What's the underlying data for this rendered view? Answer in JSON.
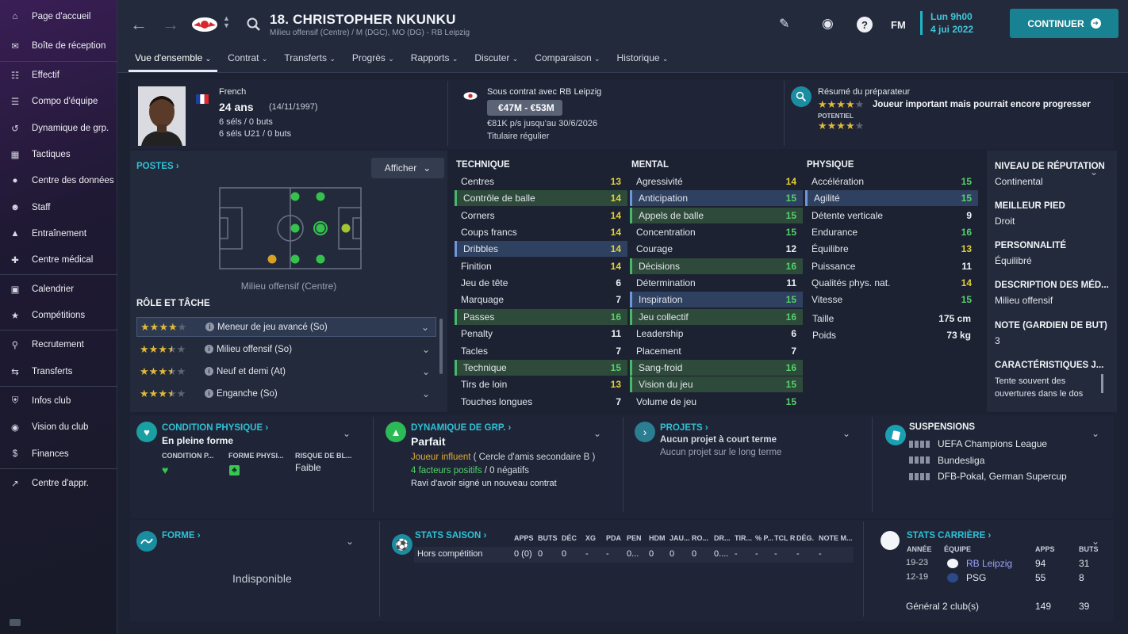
{
  "sidebar": {
    "items": [
      {
        "label": "Page d'accueil",
        "icon": "home-icon"
      },
      {
        "label": "Boîte de réception",
        "icon": "inbox-icon"
      },
      {
        "label": "Effectif",
        "icon": "squad-icon"
      },
      {
        "label": "Compo d'équipe",
        "icon": "clipboard-icon"
      },
      {
        "label": "Dynamique de grp.",
        "icon": "dynamics-icon"
      },
      {
        "label": "Tactiques",
        "icon": "tactics-icon"
      },
      {
        "label": "Centre des données",
        "icon": "data-icon"
      },
      {
        "label": "Staff",
        "icon": "staff-icon"
      },
      {
        "label": "Entraînement",
        "icon": "training-icon"
      },
      {
        "label": "Centre médical",
        "icon": "medical-icon"
      },
      {
        "label": "Calendrier",
        "icon": "calendar-icon"
      },
      {
        "label": "Compétitions",
        "icon": "trophy-icon"
      },
      {
        "label": "Recrutement",
        "icon": "search-icon"
      },
      {
        "label": "Transferts",
        "icon": "transfers-icon"
      },
      {
        "label": "Infos club",
        "icon": "shield-icon"
      },
      {
        "label": "Vision du club",
        "icon": "vision-icon"
      },
      {
        "label": "Finances",
        "icon": "finances-icon"
      },
      {
        "label": "Centre d'appr.",
        "icon": "learning-icon"
      }
    ]
  },
  "header": {
    "title": "18. CHRISTOPHER NKUNKU",
    "subtitle": "Milieu offensif (Centre) / M (DGC), MO (DG) - RB Leipzig",
    "fm_label": "FM",
    "date_line1": "Lun 9h00",
    "date_line2": "4 jui 2022",
    "continue_label": "CONTINUER",
    "tabs": [
      "Vue d'ensemble",
      "Contrat",
      "Transferts",
      "Progrès",
      "Rapports",
      "Discuter",
      "Comparaison",
      "Historique"
    ]
  },
  "profile": {
    "nationality": "French",
    "age": "24 ans",
    "dob": "(14/11/1997)",
    "caps": "6 séls / 0 buts",
    "caps_u21": "6 séls U21 / 0 buts",
    "contract_label": "Sous contrat avec RB Leipzig",
    "value_range": "€47M - €53M",
    "wage": "€81K p/s jusqu'au 30/6/2026",
    "status": "Titulaire régulier",
    "coach_title": "Résumé du préparateur",
    "coach_summary": "Joueur important mais pourrait encore progresser",
    "potential_label": "POTENTIEL",
    "current_stars": 4,
    "potential_stars": 4
  },
  "positions": {
    "title": "POSTES",
    "show_label": "Afficher",
    "position_label": "Milieu offensif (Centre)",
    "role_title": "RÔLE ET TÂCHE",
    "roles": [
      {
        "label": "Meneur de jeu avancé (So)",
        "stars": 4
      },
      {
        "label": "Milieu offensif (So)",
        "stars": 3.5
      },
      {
        "label": "Neuf et demi (At)",
        "stars": 3.5
      },
      {
        "label": "Enganche (So)",
        "stars": 3.5
      }
    ]
  },
  "attributes": {
    "technique_title": "TECHNIQUE",
    "mental_title": "MENTAL",
    "physique_title": "PHYSIQUE",
    "technique": [
      {
        "name": "Centres",
        "value": 13,
        "hl": ""
      },
      {
        "name": "Contrôle de balle",
        "value": 14,
        "hl": "green"
      },
      {
        "name": "Corners",
        "value": 14,
        "hl": ""
      },
      {
        "name": "Coups francs",
        "value": 14,
        "hl": ""
      },
      {
        "name": "Dribbles",
        "value": 14,
        "hl": "blue"
      },
      {
        "name": "Finition",
        "value": 14,
        "hl": ""
      },
      {
        "name": "Jeu de tête",
        "value": 6,
        "hl": ""
      },
      {
        "name": "Marquage",
        "value": 7,
        "hl": ""
      },
      {
        "name": "Passes",
        "value": 16,
        "hl": "green"
      },
      {
        "name": "Penalty",
        "value": 11,
        "hl": ""
      },
      {
        "name": "Tacles",
        "value": 7,
        "hl": ""
      },
      {
        "name": "Technique",
        "value": 15,
        "hl": "green"
      },
      {
        "name": "Tirs de loin",
        "value": 13,
        "hl": ""
      },
      {
        "name": "Touches longues",
        "value": 7,
        "hl": ""
      }
    ],
    "mental": [
      {
        "name": "Agressivité",
        "value": 14,
        "hl": ""
      },
      {
        "name": "Anticipation",
        "value": 15,
        "hl": "blue"
      },
      {
        "name": "Appels de balle",
        "value": 15,
        "hl": "green"
      },
      {
        "name": "Concentration",
        "value": 15,
        "hl": ""
      },
      {
        "name": "Courage",
        "value": 12,
        "hl": ""
      },
      {
        "name": "Décisions",
        "value": 16,
        "hl": "green"
      },
      {
        "name": "Détermination",
        "value": 11,
        "hl": ""
      },
      {
        "name": "Inspiration",
        "value": 15,
        "hl": "blue"
      },
      {
        "name": "Jeu collectif",
        "value": 16,
        "hl": "green"
      },
      {
        "name": "Leadership",
        "value": 6,
        "hl": ""
      },
      {
        "name": "Placement",
        "value": 7,
        "hl": ""
      },
      {
        "name": "Sang-froid",
        "value": 16,
        "hl": "green"
      },
      {
        "name": "Vision du jeu",
        "value": 15,
        "hl": "green"
      },
      {
        "name": "Volume de jeu",
        "value": 15,
        "hl": ""
      }
    ],
    "physique": [
      {
        "name": "Accélération",
        "value": 15,
        "hl": ""
      },
      {
        "name": "Agilité",
        "value": 15,
        "hl": "blue"
      },
      {
        "name": "Détente verticale",
        "value": 9,
        "hl": ""
      },
      {
        "name": "Endurance",
        "value": 16,
        "hl": ""
      },
      {
        "name": "Équilibre",
        "value": 13,
        "hl": ""
      },
      {
        "name": "Puissance",
        "value": 11,
        "hl": ""
      },
      {
        "name": "Qualités phys. nat.",
        "value": 14,
        "hl": ""
      },
      {
        "name": "Vitesse",
        "value": 15,
        "hl": ""
      }
    ],
    "height_label": "Taille",
    "height_value": "175 cm",
    "weight_label": "Poids",
    "weight_value": "73 kg"
  },
  "side_info": [
    {
      "label": "NIVEAU DE RÉPUTATION",
      "value": "Continental"
    },
    {
      "label": "MEILLEUR PIED",
      "value": "Droit"
    },
    {
      "label": "PERSONNALITÉ",
      "value": "Équilibré"
    },
    {
      "label": "DESCRIPTION DES MÉD...",
      "value": "Milieu offensif"
    },
    {
      "label": "NOTE (GARDIEN DE BUT)",
      "value": "3"
    },
    {
      "label": "CARACTÉRISTIQUES J...",
      "value": "Tente souvent des ouvertures dans le dos"
    }
  ],
  "condition": {
    "title": "CONDITION PHYSIQUE",
    "status": "En pleine forme",
    "col1": "CONDITION P...",
    "col2": "FORME PHYSI...",
    "col3": "RISQUE DE BL...",
    "risk": "Faible"
  },
  "dynamics": {
    "title": "DYNAMIQUE DE GRP.",
    "status": "Parfait",
    "influence": "Joueur influent",
    "circle": "( Cercle d'amis secondaire B )",
    "positive": "4 facteurs positifs",
    "negative": "/ 0 négatifs",
    "note": "Ravi d'avoir signé un nouveau contrat"
  },
  "projects": {
    "title": "PROJETS",
    "short": "Aucun projet à court terme",
    "long": "Aucun projet sur le long terme"
  },
  "suspensions": {
    "title": "SUSPENSIONS",
    "items": [
      "UEFA Champions League",
      "Bundesliga",
      "DFB-Pokal, German Supercup"
    ]
  },
  "form": {
    "title": "FORME",
    "status": "Indisponible"
  },
  "season_stats": {
    "title": "STATS SAISON",
    "headers": [
      "APPS",
      "BUTS",
      "DÉC",
      "XG",
      "PDA",
      "PEN",
      "HDM",
      "JAU...",
      "RO...",
      "DR...",
      "TIR...",
      "% P...",
      "TCL R",
      "DÉG.",
      "NOTE M..."
    ],
    "row_label": "Hors compétition",
    "row": [
      "0 (0)",
      "0",
      "0",
      "-",
      "-",
      "0...",
      "0",
      "0",
      "0",
      "0....",
      "-",
      "-",
      "-",
      "-",
      "-"
    ]
  },
  "career_stats": {
    "title": "STATS CARRIÈRE",
    "h_year": "ANNÉE",
    "h_team": "ÉQUIPE",
    "h_apps": "APPS",
    "h_goals": "BUTS",
    "rows": [
      {
        "year": "19-23",
        "team": "RB Leipzig",
        "apps": "94",
        "goals": "31"
      },
      {
        "year": "12-19",
        "team": "PSG",
        "apps": "55",
        "goals": "8"
      }
    ],
    "total_label": "Général 2 club(s)",
    "total_apps": "149",
    "total_goals": "39"
  }
}
